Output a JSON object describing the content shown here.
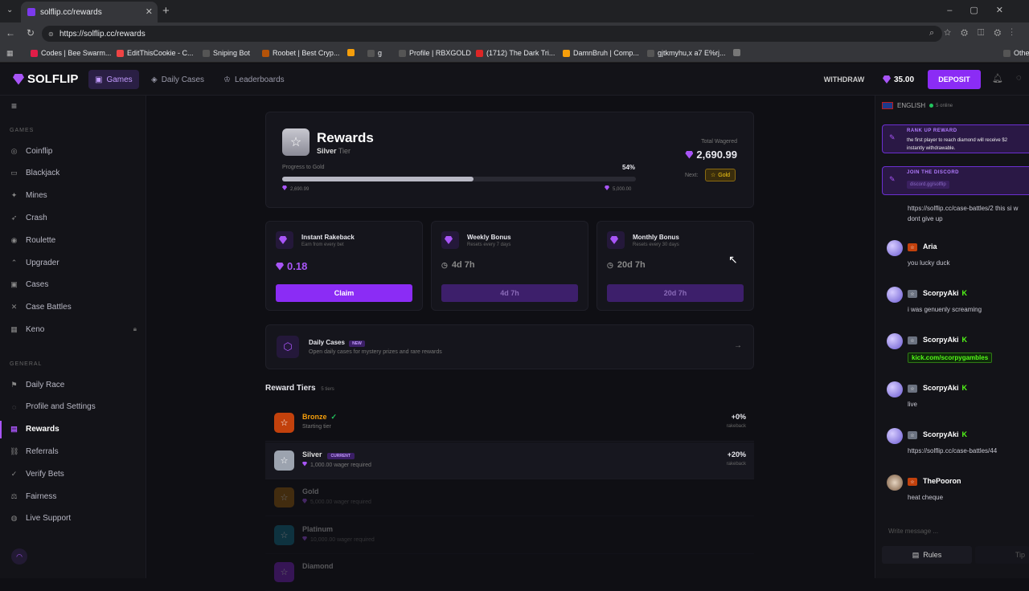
{
  "browser": {
    "tab_title": "solflip.cc/rewards",
    "url": "https://solflip.cc/rewards",
    "bookmarks": [
      "Codes | Bee Swarm...",
      "EditThisCookie - C...",
      "Sniping Bot",
      "Roobet | Best Cryp...",
      "",
      "g",
      "Profile | RBXGOLD",
      "(1712) The Dark Tri...",
      "DamnBruh | Comp...",
      "gjtkmyhu,x a7 E%rj...",
      "",
      "Othe"
    ]
  },
  "topnav": {
    "brand": "SOLFLIP",
    "games": "Games",
    "daily_cases": "Daily Cases",
    "leaderboards": "Leaderboards",
    "withdraw": "WITHDRAW",
    "balance": "35.00",
    "deposit": "DEPOSIT"
  },
  "sidebar": {
    "games_header": "GAMES",
    "general_header": "GENERAL",
    "games": [
      {
        "label": "Coinflip",
        "icon": "coin-icon"
      },
      {
        "label": "Blackjack",
        "icon": "cards-icon"
      },
      {
        "label": "Mines",
        "icon": "mines-icon"
      },
      {
        "label": "Crash",
        "icon": "rocket-icon"
      },
      {
        "label": "Roulette",
        "icon": "roulette-icon"
      },
      {
        "label": "Upgrader",
        "icon": "arrow-up-icon"
      },
      {
        "label": "Cases",
        "icon": "box-icon"
      },
      {
        "label": "Case Battles",
        "icon": "swords-icon"
      },
      {
        "label": "Keno",
        "icon": "grid-icon"
      }
    ],
    "general": [
      {
        "label": "Daily Race",
        "icon": "flag-icon"
      },
      {
        "label": "Profile and Settings",
        "icon": "user-icon"
      },
      {
        "label": "Rewards",
        "icon": "gift-icon"
      },
      {
        "label": "Referrals",
        "icon": "link-icon"
      },
      {
        "label": "Verify Bets",
        "icon": "check-icon"
      },
      {
        "label": "Fairness",
        "icon": "scale-icon"
      },
      {
        "label": "Live Support",
        "icon": "chat-icon"
      }
    ]
  },
  "rewards": {
    "title": "Rewards",
    "tier": "Silver",
    "tier_suffix": "Tier",
    "progress_label": "Progress to Gold",
    "progress_pct_text": "54%",
    "progress_fraction": 0.54,
    "progress_from": "2,690.99",
    "progress_to": "5,000.00",
    "total_wagered_label": "Total Wagered",
    "total_wagered": "2,690.99",
    "next_label": "Next:",
    "next_tier": "Gold"
  },
  "bonuses": [
    {
      "title": "Instant Rakeback",
      "sub": "Earn from every bet",
      "value": "0.18",
      "button": "Claim"
    },
    {
      "title": "Weekly Bonus",
      "sub": "Resets every 7 days",
      "value": "4d 7h",
      "button": "4d 7h"
    },
    {
      "title": "Monthly Bonus",
      "sub": "Resets every 30 days",
      "value": "20d 7h",
      "button": "20d 7h"
    }
  ],
  "daily_cases": {
    "title": "Daily Cases",
    "badge": "NEW",
    "sub": "Open daily cases for mystery prizes and rare rewards"
  },
  "tiers_header": {
    "title": "Reward Tiers",
    "count": "5 tiers"
  },
  "tiers": [
    {
      "name": "Bronze",
      "sub": "Starting tier",
      "pct": "+0%",
      "label": "rakeback",
      "tag": "✓",
      "color": "#c2410c"
    },
    {
      "name": "Silver",
      "sub": "1,000.00 wager required",
      "pct": "+20%",
      "label": "rakeback",
      "tag": "CURRENT",
      "color": "#9ca3af"
    },
    {
      "name": "Gold",
      "sub": "5,000.00 wager required",
      "pct": "",
      "label": "",
      "tag": "",
      "color": "#a16207"
    },
    {
      "name": "Platinum",
      "sub": "10,000.00 wager required",
      "pct": "",
      "label": "",
      "tag": "",
      "color": "#0e7490"
    },
    {
      "name": "Diamond",
      "sub": "",
      "pct": "",
      "label": "",
      "tag": "",
      "color": "#7e22ce"
    }
  ],
  "chat": {
    "language": "ENGLISH",
    "online": "5 online",
    "promo1_title": "RANK UP REWARD",
    "promo1_text1": "the first player to reach diamond will receive $2",
    "promo1_text2": "instantly withdrawable.",
    "promo2_title": "JOIN THE DISCORD",
    "promo2_text": "discord.gg/solflip",
    "top_msg1": "https://solflip.cc/case-battles/2 this si w",
    "top_msg2": "dont give up",
    "messages": [
      {
        "user": "Aria",
        "text": "you lucky duck",
        "k": ""
      },
      {
        "user": "ScorpyAki",
        "text": "i was genuenly screaming",
        "k": "K"
      },
      {
        "user": "ScorpyAki",
        "text": "kick.com/scorpygambles",
        "k": "K"
      },
      {
        "user": "ScorpyAki",
        "text": "live",
        "k": "K"
      },
      {
        "user": "ScorpyAki",
        "text": "https://solflip.cc/case-battles/44",
        "k": "K"
      },
      {
        "user": "ThePooron",
        "text": "heat cheque",
        "k": ""
      }
    ],
    "input_placeholder": "Write message ...",
    "rules": "Rules",
    "tip": "Tip"
  }
}
